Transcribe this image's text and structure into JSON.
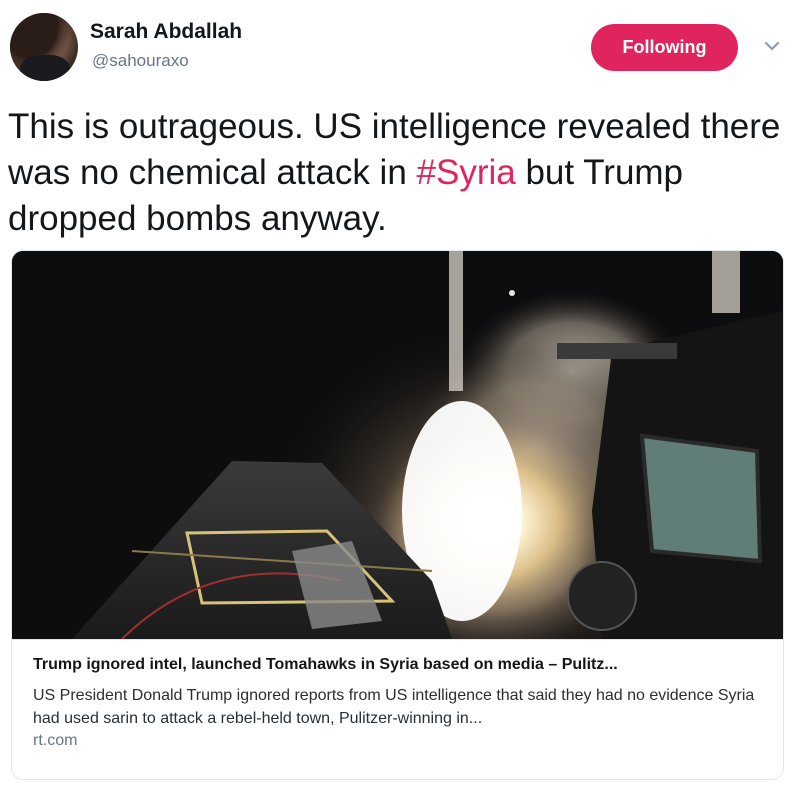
{
  "author": {
    "name": "Sarah Abdallah",
    "handle": "@sahouraxo"
  },
  "follow_button": {
    "label": "Following",
    "color": "#e0245e"
  },
  "more_menu": {
    "icon": "chevron-down-icon"
  },
  "tweet": {
    "text_before": "This is outrageous. US intelligence revealed there was no chemical attack in ",
    "hashtag": "#Syria",
    "text_after": " but Trump dropped bombs anyway.",
    "hashtag_color": "#e0245e"
  },
  "link_card": {
    "title": "Trump ignored intel, launched Tomahawks in Syria based on media – Pulitz...",
    "description": "US President Donald Trump ignored reports from US intelligence that said they had no evidence Syria had used sarin to attack a rebel-held town, Pulitzer-winning in...",
    "domain": "rt.com"
  }
}
